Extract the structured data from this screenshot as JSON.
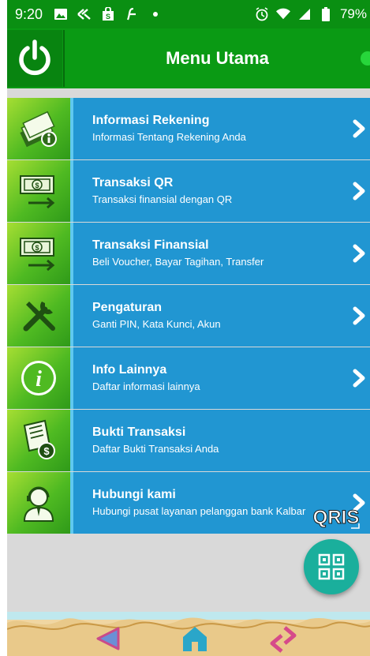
{
  "status_bar": {
    "time": "9:20",
    "battery": "79%",
    "left_icons": [
      "image-icon",
      "kx-icon",
      "shopping-bag-icon",
      "flash-icon",
      "dot-icon"
    ],
    "right_icons": [
      "alarm-icon",
      "wifi-icon",
      "signal-icon",
      "battery-icon"
    ]
  },
  "header": {
    "title": "Menu Utama",
    "status_color": "#27d63b"
  },
  "menu": [
    {
      "icon": "money-info-icon",
      "title": "Informasi Rekening",
      "subtitle": "Informasi Tentang Rekening Anda",
      "chevron": true
    },
    {
      "icon": "money-transfer-icon",
      "title": "Transaksi QR",
      "subtitle": "Transaksi finansial dengan QR",
      "chevron": true
    },
    {
      "icon": "money-transfer-icon",
      "title": "Transaksi Finansial",
      "subtitle": "Beli Voucher, Bayar Tagihan, Transfer",
      "chevron": true
    },
    {
      "icon": "tools-icon",
      "title": "Pengaturan",
      "subtitle": "Ganti PIN, Kata Kunci, Akun",
      "chevron": true
    },
    {
      "icon": "info-icon",
      "title": "Info Lainnya",
      "subtitle": "Daftar informasi lainnya",
      "chevron": true
    },
    {
      "icon": "receipt-icon",
      "title": "Bukti Transaksi",
      "subtitle": "Daftar Bukti Transaksi Anda",
      "chevron": false
    },
    {
      "icon": "customer-service-icon",
      "title": "Hubungi kami",
      "subtitle": "Hubungi pusat layanan pelanggan bank Kalbar",
      "chevron": true
    }
  ],
  "qris_label": "QRIS",
  "fab_icon": "qr-code-icon",
  "bottom_nav": [
    "back-icon",
    "home-icon",
    "switch-icon"
  ],
  "colors": {
    "header": "#0a9a14",
    "menu_row": "#2196d2",
    "icon_tile": "#4fba22",
    "fab": "#1aaf9c"
  }
}
